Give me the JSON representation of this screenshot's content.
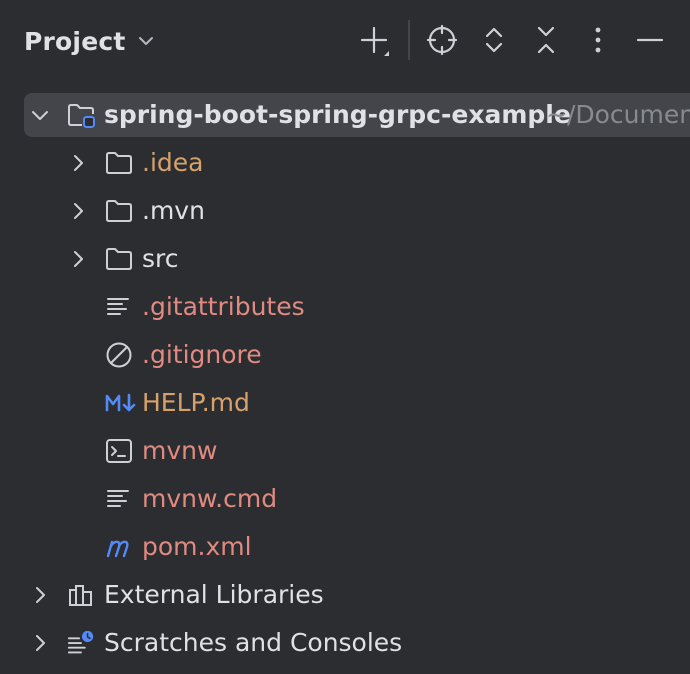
{
  "colors": {
    "background": "#2b2d30",
    "text": "#dfe1e5",
    "muted": "#868a91",
    "selection": "#43454a",
    "excluded_folder": "#d6a16b",
    "untracked_file": "#e08a82",
    "markdown_icon": "#548af7",
    "maven_icon": "#548af7"
  },
  "header": {
    "title": "Project",
    "title_dropdown_icon": "chevron-down-icon",
    "toolbar": [
      "plus-new-icon",
      "locate-target-icon",
      "expand-all-icon",
      "collapse-all-icon",
      "more-options-icon",
      "minimize-icon"
    ]
  },
  "tree": {
    "root": {
      "name": "spring-boot-spring-grpc-example",
      "path": "~/Documen",
      "icon": "module-folder-icon",
      "expanded": true
    },
    "children": [
      {
        "name": ".idea",
        "icon": "folder-icon",
        "expandable": true,
        "status": "excluded"
      },
      {
        "name": ".mvn",
        "icon": "folder-icon",
        "expandable": true,
        "status": "normal"
      },
      {
        "name": "src",
        "icon": "folder-icon",
        "expandable": true,
        "status": "normal"
      },
      {
        "name": ".gitattributes",
        "icon": "text-file-icon",
        "expandable": false,
        "status": "untracked"
      },
      {
        "name": ".gitignore",
        "icon": "ignore-file-icon",
        "expandable": false,
        "status": "untracked"
      },
      {
        "name": "HELP.md",
        "icon": "markdown-icon",
        "expandable": false,
        "status": "excluded"
      },
      {
        "name": "mvnw",
        "icon": "shell-script-icon",
        "expandable": false,
        "status": "untracked"
      },
      {
        "name": "mvnw.cmd",
        "icon": "text-file-icon",
        "expandable": false,
        "status": "untracked"
      },
      {
        "name": "pom.xml",
        "icon": "maven-icon",
        "expandable": false,
        "status": "untracked"
      }
    ],
    "bottom": [
      {
        "name": "External Libraries",
        "icon": "libraries-icon"
      },
      {
        "name": "Scratches and Consoles",
        "icon": "scratches-icon"
      }
    ]
  }
}
